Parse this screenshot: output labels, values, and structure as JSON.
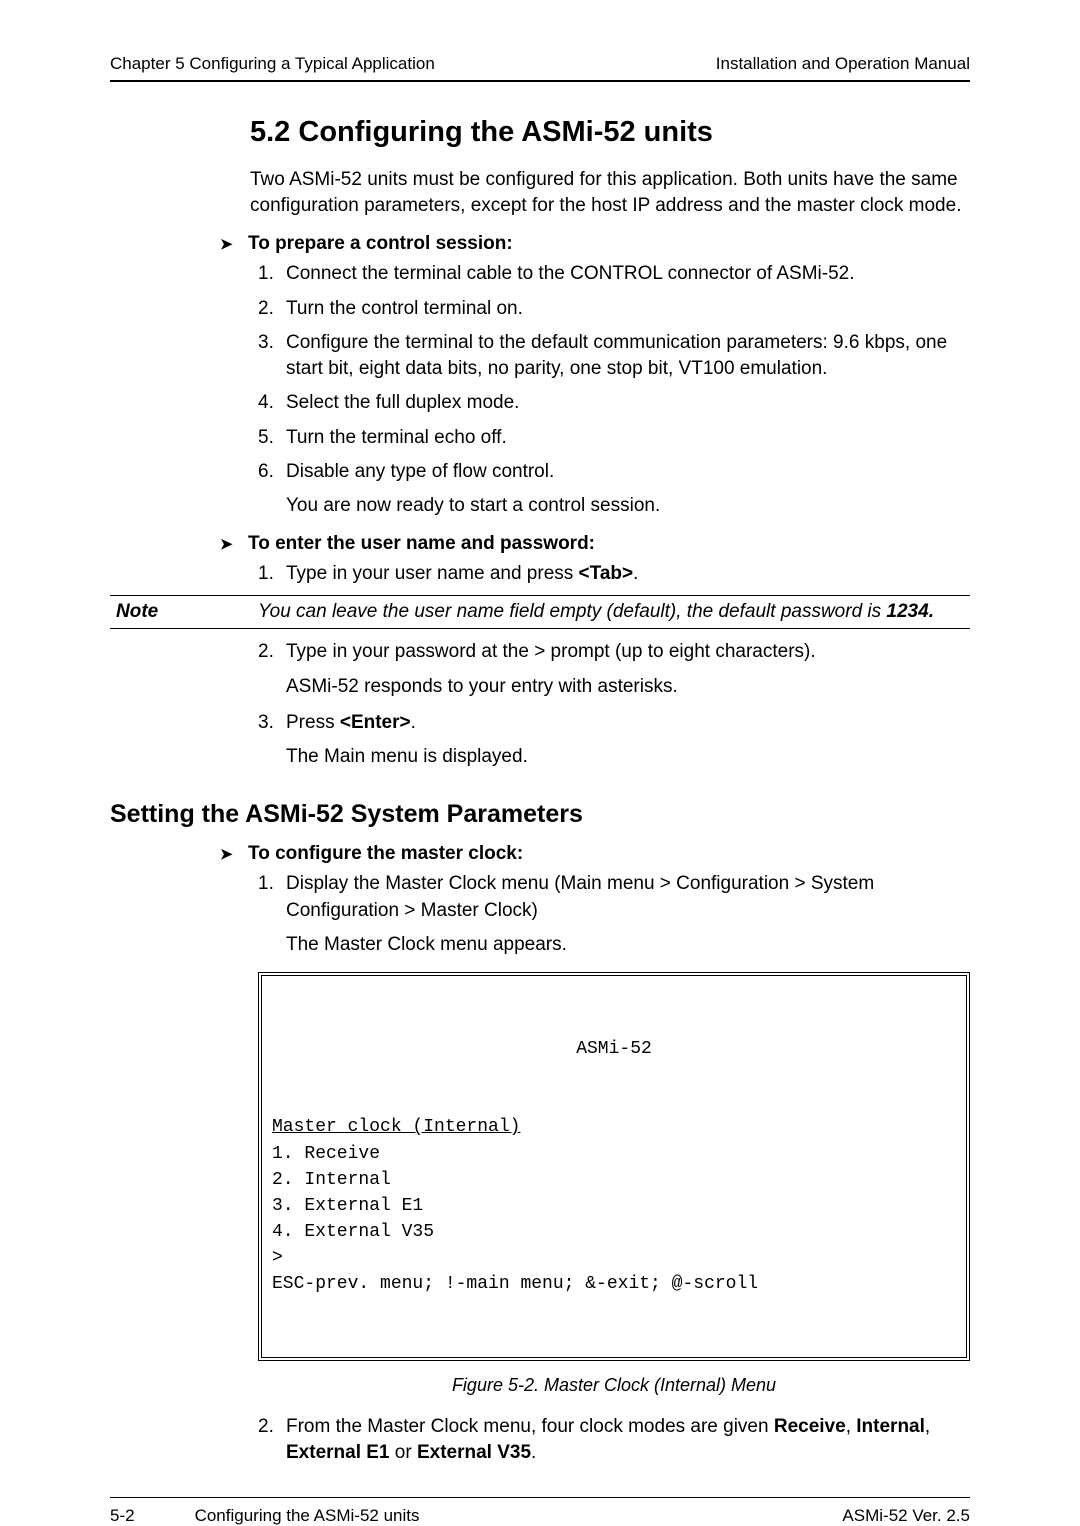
{
  "header": {
    "left": "Chapter 5  Configuring a Typical Application",
    "right": "Installation and Operation Manual"
  },
  "section": {
    "heading": "5.2  Configuring the ASMi-52 units",
    "intro": "Two ASMi-52 units must be configured for this application. Both units have the same configuration parameters, except for the host IP address and the master clock mode."
  },
  "proc_prepare": {
    "lead": "To prepare a control session:",
    "items": [
      "Connect the terminal cable to the CONTROL connector of ASMi-52.",
      "Turn the control terminal on.",
      "Configure the terminal to the default communication parameters: 9.6 kbps, one start bit, eight data bits, no parity, one stop bit, VT100 emulation.",
      "Select the full duplex mode.",
      "Turn the terminal echo off.",
      "Disable any type of flow control."
    ],
    "tail": "You are now ready to start a control session."
  },
  "proc_login": {
    "lead": "To enter the user name and password:",
    "step1_pre": "Type in your user name and press ",
    "step1_key": "<Tab>",
    "step1_post": ".",
    "note_label": "Note",
    "note_text_pre": "You can leave the user name field empty (default), the default password is ",
    "note_pw": "1234.",
    "step2": "Type in your password at the > prompt (up to eight characters).",
    "step2_sub": "ASMi-52 responds to your entry with asterisks.",
    "step3_pre": "Press ",
    "step3_key": "<Enter>",
    "step3_post": ".",
    "step3_sub": "The Main menu is displayed."
  },
  "sys_params": {
    "heading": "Setting the ASMi-52 System Parameters",
    "proc_clock_lead": "To configure the master clock:",
    "step1": "Display the Master Clock menu (Main menu > Configuration > System Configuration > Master Clock)",
    "step1_sub": "The Master Clock menu appears.",
    "terminal": {
      "title": "ASMi-52",
      "header_line": "Master clock (Internal)",
      "opt1": "1. Receive",
      "opt2": "2. Internal",
      "opt3": "3. External E1",
      "opt4": "4. External V35",
      "prompt": ">",
      "footer": "ESC-prev. menu; !-main menu; &-exit; @-scroll"
    },
    "fig_caption": "Figure 5-2.  Master Clock (Internal) Menu",
    "step2_pre": "From the Master Clock menu, four clock modes are given ",
    "step2_m1": "Receive",
    "step2_sep1": ", ",
    "step2_m2": "Internal",
    "step2_sep2": ", ",
    "step2_m3": "External E1",
    "step2_or": " or ",
    "step2_m4": "External V35",
    "step2_post": "."
  },
  "footer": {
    "page": "5-2",
    "section": "Configuring the ASMi-52 units",
    "version": "ASMi-52 Ver.  2.5"
  }
}
